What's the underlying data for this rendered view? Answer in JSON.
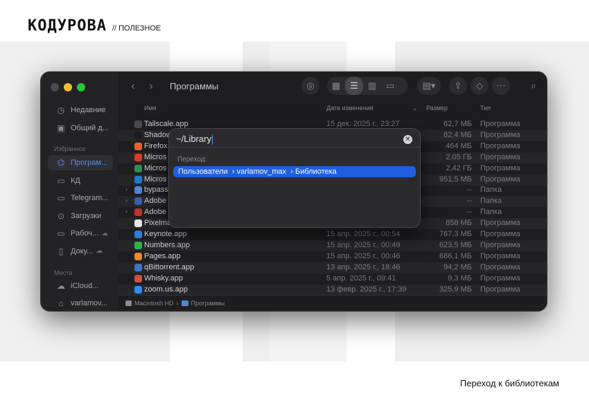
{
  "brand": {
    "logo": "КОДУРОВА",
    "tag": "// ПОЛЕЗНОЕ"
  },
  "caption": "Переход к библиотекам",
  "window": {
    "title": "Программы",
    "sidebar": {
      "items_top": [
        {
          "label": "Недавние",
          "icon": "clock-icon"
        },
        {
          "label": "Общий д...",
          "icon": "shared-folder-icon"
        }
      ],
      "favorites_header": "Избранное",
      "favorites": [
        {
          "label": "Програм...",
          "icon": "apps-icon",
          "selected": true
        },
        {
          "label": "КД",
          "icon": "folder-icon"
        },
        {
          "label": "Telegram...",
          "icon": "folder-icon"
        },
        {
          "label": "Загрузки",
          "icon": "download-icon"
        },
        {
          "label": "Рабоч...",
          "icon": "desktop-icon",
          "extra": "☁"
        },
        {
          "label": "Доку...",
          "icon": "document-icon",
          "extra": "☁"
        }
      ],
      "places_header": "Места",
      "places": [
        {
          "label": "iCloud...",
          "icon": "cloud-icon"
        },
        {
          "label": "varlamov...",
          "icon": "home-icon"
        }
      ]
    },
    "columns": {
      "name": "Имя",
      "date": "Дата изменения",
      "size": "Размер",
      "kind": "Тип"
    },
    "rows": [
      {
        "name": "Tailscale.app",
        "date": "15 дек. 2025 г., 23:27",
        "size": "62,7 МБ",
        "kind": "Программа",
        "color": "#4a4a4e",
        "folder": false
      },
      {
        "name": "Shadow",
        "date": "",
        "size": "82,4 МБ",
        "kind": "Программа",
        "color": "#1c1c1e",
        "folder": false
      },
      {
        "name": "Firefox",
        "date": "",
        "size": "464 МБ",
        "kind": "Программа",
        "color": "#e8632b",
        "folder": false
      },
      {
        "name": "Micros",
        "date": "",
        "size": "2,05 ГБ",
        "kind": "Программа",
        "color": "#d83b2b",
        "folder": false
      },
      {
        "name": "Micros",
        "date": "",
        "size": "2,42 ГБ",
        "kind": "Программа",
        "color": "#2f8f4f",
        "folder": false
      },
      {
        "name": "Micros",
        "date": "",
        "size": "951,5 МБ",
        "kind": "Программа",
        "color": "#1e7bd6",
        "folder": false
      },
      {
        "name": "bypass",
        "date": "",
        "size": "--",
        "kind": "Папка",
        "color": "#4f86d6",
        "folder": true
      },
      {
        "name": "Adobe",
        "date": "",
        "size": "--",
        "kind": "Папка",
        "color": "#3a5fa8",
        "folder": true
      },
      {
        "name": "Adobe",
        "date": "",
        "size": "--",
        "kind": "Папка",
        "color": "#c03030",
        "folder": true
      },
      {
        "name": "Pixelma",
        "date": "",
        "size": "858 МБ",
        "kind": "Программа",
        "color": "#e6e6e6",
        "folder": false
      },
      {
        "name": "Keynote.app",
        "date": "15 апр. 2025 г., 00:54",
        "size": "767,3 МБ",
        "kind": "Программа",
        "color": "#2d7de0",
        "folder": false
      },
      {
        "name": "Numbers.app",
        "date": "15 апр. 2025 г., 00:49",
        "size": "623,5 МБ",
        "kind": "Программа",
        "color": "#2fb34a",
        "folder": false
      },
      {
        "name": "Pages.app",
        "date": "15 апр. 2025 г., 00:46",
        "size": "686,1 МБ",
        "kind": "Программа",
        "color": "#f08a24",
        "folder": false
      },
      {
        "name": "qBittorrent.app",
        "date": "13 апр. 2025 г., 18:46",
        "size": "94,2 МБ",
        "kind": "Программа",
        "color": "#3a78c8",
        "folder": false
      },
      {
        "name": "Whisky.app",
        "date": "5 апр. 2025 г., 09:41",
        "size": "9,3 МБ",
        "kind": "Программа",
        "color": "#d84a4a",
        "folder": false
      },
      {
        "name": "zoom.us.app",
        "date": "13 февр. 2025 г., 17:39",
        "size": "325,9 МБ",
        "kind": "Программа",
        "color": "#2d8cff",
        "folder": false
      }
    ],
    "pathbar": {
      "disk": "Macintosh HD",
      "sep": "›",
      "folder": "Программы"
    }
  },
  "goto_dialog": {
    "input_value": "~/Library",
    "section_label": "Переход:",
    "suggestion": "Пользователи  › varlamov_max  › Библиотека"
  }
}
